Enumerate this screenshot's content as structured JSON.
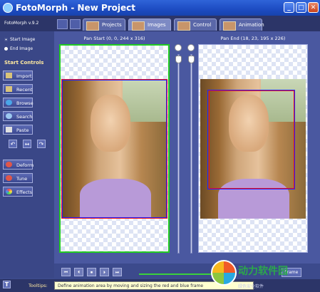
{
  "window": {
    "title": "FotoMorph - New Project",
    "minimize": "_",
    "maximize": "□",
    "close": "✕"
  },
  "header": {
    "version": "FotoMorph v.9.2"
  },
  "tabs": [
    {
      "label": "Projects"
    },
    {
      "label": "Images"
    },
    {
      "label": "Control"
    },
    {
      "label": "Animation"
    }
  ],
  "sidebar": {
    "radio_start": "Start Image",
    "radio_end": "End Image",
    "section_title": "Start Controls",
    "buttons": [
      "Import",
      "Recent",
      "Browse",
      "Search",
      "Paste"
    ],
    "effect_buttons": [
      "Deform",
      "Tune",
      "Effects"
    ]
  },
  "panels": {
    "start_label": "Pan Start (0, 0, 244 x 316)",
    "end_label": "Pan End (18, 23, 195 x 226)"
  },
  "bottom": {
    "frame_button": "Frame"
  },
  "status": {
    "tooltips_label": "Tooltips:",
    "tooltip_text": "Define animation area by moving and sizing the red and blue frame"
  },
  "watermark": {
    "text": "动力软件园",
    "sub": "绿色安全软件"
  },
  "colors": {
    "accent": "#3a4787",
    "title": "#1d4cc2",
    "green_frame": "#22cc22",
    "red_frame": "#ee1111",
    "blue_frame": "#2222ff"
  }
}
